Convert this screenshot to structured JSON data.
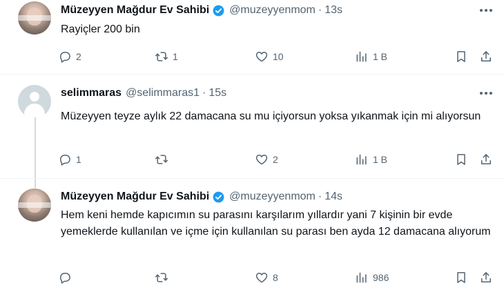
{
  "tweets": [
    {
      "author_name": "Müzeyyen Mağdur Ev Sahibi",
      "handle": "@muzeyyenmom",
      "separator": "·",
      "time": "13s",
      "text": "Rayiçler 200 bin",
      "replies": "2",
      "retweets": "1",
      "likes": "10",
      "views": "1 B",
      "verified": true,
      "avatar": "photo"
    },
    {
      "author_name": "selimmaras",
      "handle": "@selimmaras1",
      "separator": "·",
      "time": "15s",
      "text": "Müzeyyen teyze aylık 22 damacana su mu içiyorsun yoksa yıkanmak için mi alıyorsun",
      "replies": "1",
      "retweets": "",
      "likes": "2",
      "views": "1 B",
      "verified": false,
      "avatar": "default"
    },
    {
      "author_name": "Müzeyyen Mağdur Ev Sahibi",
      "handle": "@muzeyyenmom",
      "separator": "·",
      "time": "14s",
      "text": "Hem keni hemde kapıcımın su parasını karşılarım yıllardır yani 7  kişinin bir evde yemeklerde kullanılan ve içme için kullanılan su parası ben ayda 12 damacana alıyorum",
      "replies": "",
      "retweets": "",
      "likes": "8",
      "views": "986",
      "verified": true,
      "avatar": "photo"
    }
  ],
  "colors": {
    "verified_blue": "#1d9bf0",
    "secondary_text": "#536471",
    "primary_text": "#0f1419",
    "divider": "#eff3f4",
    "thread_line": "#cfd9de"
  },
  "icons": [
    "more-icon",
    "reply-icon",
    "retweet-icon",
    "like-icon",
    "views-icon",
    "bookmark-icon",
    "share-icon",
    "verified-badge-icon"
  ]
}
